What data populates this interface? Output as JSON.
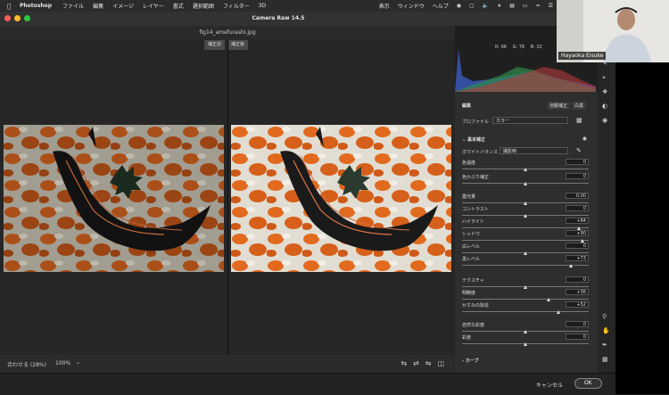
{
  "menubar": {
    "app": "Photoshop",
    "items": [
      "ファイル",
      "編集",
      "イメージ",
      "レイヤー",
      "書式",
      "選択範囲",
      "フィルター",
      "3D"
    ],
    "right_items": [
      "表示",
      "ウィンドウ",
      "ヘルプ"
    ]
  },
  "window": {
    "title": "Camera Raw 14.5"
  },
  "file": {
    "name": "fig14_amefurashi.jpg"
  },
  "view_tabs": [
    "補正前",
    "補正後"
  ],
  "histogram": {
    "r": "R: 96",
    "g": "G: 78",
    "b": "B: 32"
  },
  "panel": {
    "title": "編集",
    "auto_button": "自動補正",
    "bw_button": "白黒",
    "profile_label": "プロファイル",
    "profile_value": "カラー",
    "basic_section": "基本補正",
    "wb_label": "ホワイトバランス",
    "wb_value": "撮影時",
    "sliders": [
      {
        "label": "色温度",
        "value": "0",
        "pos": 0.5
      },
      {
        "label": "色かぶり補正",
        "value": "0",
        "pos": 0.5
      },
      {
        "label": "露光量",
        "value": "0.00",
        "pos": 0.5
      },
      {
        "label": "コントラスト",
        "value": "0",
        "pos": 0.5
      },
      {
        "label": "ハイライト",
        "value": "+84",
        "pos": 0.92
      },
      {
        "label": "シャドウ",
        "value": "+90",
        "pos": 0.95
      },
      {
        "label": "白レベル",
        "value": "0",
        "pos": 0.5
      },
      {
        "label": "黒レベル",
        "value": "+73",
        "pos": 0.86
      },
      {
        "label": "テクスチャ",
        "value": "0",
        "pos": 0.5
      },
      {
        "label": "明瞭度",
        "value": "+36",
        "pos": 0.68
      },
      {
        "label": "かすみの除去",
        "value": "+52",
        "pos": 0.76
      },
      {
        "label": "自然な彩度",
        "value": "0",
        "pos": 0.5
      },
      {
        "label": "彩度",
        "value": "0",
        "pos": 0.5
      }
    ],
    "curve_section": "カーブ"
  },
  "status": {
    "fit": "合わせる (28%)",
    "zoom": "100%"
  },
  "buttons": {
    "cancel": "キャンセル",
    "ok": "OK"
  },
  "webcam": {
    "name": "Hayaoka Eisuke"
  },
  "colors": {
    "accent": "#ffffff",
    "bg": "#1e1e1e",
    "panel": "#2e2e2e"
  }
}
